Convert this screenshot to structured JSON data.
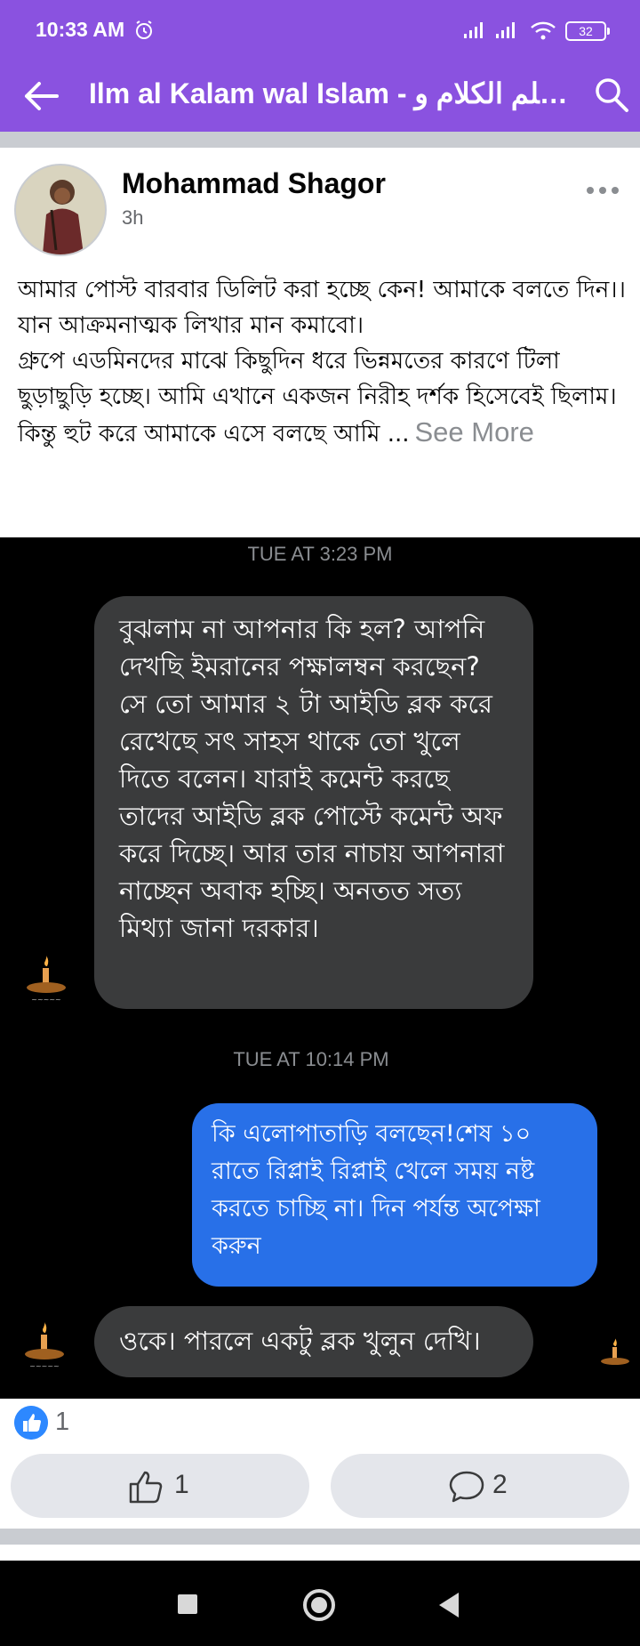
{
  "status_bar": {
    "time": "10:33 AM",
    "battery": "32",
    "icons": [
      "alarm-icon",
      "signal-icon",
      "signal-icon",
      "wifi-icon",
      "battery-icon"
    ]
  },
  "app_bar": {
    "title": "Ilm al Kalam wal Islam - علم الكلام و...",
    "back_icon": "back-arrow-icon",
    "search_icon": "search-icon",
    "color": "#8a52e0"
  },
  "post": {
    "author": "Mohammad Shagor",
    "time": "3h",
    "lines": [
      "আমার পোস্ট বারবার ডিলিট করা হচ্ছে কেন! আমাকে বলতে দিন।।",
      "যান আক্রমনাত্মক লিখার মান কমাবো।",
      "গ্রুপে এডমিনদের মাঝে কিছুদিন ধরে ভিন্নমতের কারণে টিলা ছুড়াছুড়ি হচ্ছে। আমি এখানে একজন নিরীহ দর্শক হিসেবেই ছিলাম।",
      "কিন্তু হুট করে আমাকে এসে বলছে আমি ..."
    ],
    "see_more": "See More"
  },
  "chat_screenshot": {
    "timestamp_1": "TUE AT 3:23 PM",
    "message_1": "বুঝলাম না আপনার কি হল? আপনি দেখছি ইমরানের পক্ষালম্বন করছেন? সে তো আমার ২ টা আইডি ব্লক করে রেখেছে সৎ সাহস থাকে তো খুলে দিতে বলেন। যারাই কমেন্ট করছে তাদের আইডি ব্লক পোস্টে কমেন্ট অফ করে দিচ্ছে। আর তার নাচায় আপনারা নাচ্ছেন অবাক হচ্ছি।  অনতত সত্য মিথ্যা জানা দরকার।",
    "timestamp_2": "TUE AT 10:14 PM",
    "message_2": "কি এলোপাতাড়ি বলছেন!শেষ ১০ রাতে রিপ্লাই রিপ্লাই খেলে সময় নষ্ট করতে চাচ্ছি না। দিন পর্যন্ত অপেক্ষা করুন",
    "message_3": "ওকে। পারলে একটু ব্লক খুলুন দেখি।"
  },
  "reactions": {
    "count": "1",
    "icon": "like-badge-icon"
  },
  "actions": {
    "like_count": "1",
    "comment_count": "2"
  },
  "nav_bar": {
    "icons": [
      "recents-icon",
      "home-icon",
      "back-icon"
    ]
  }
}
